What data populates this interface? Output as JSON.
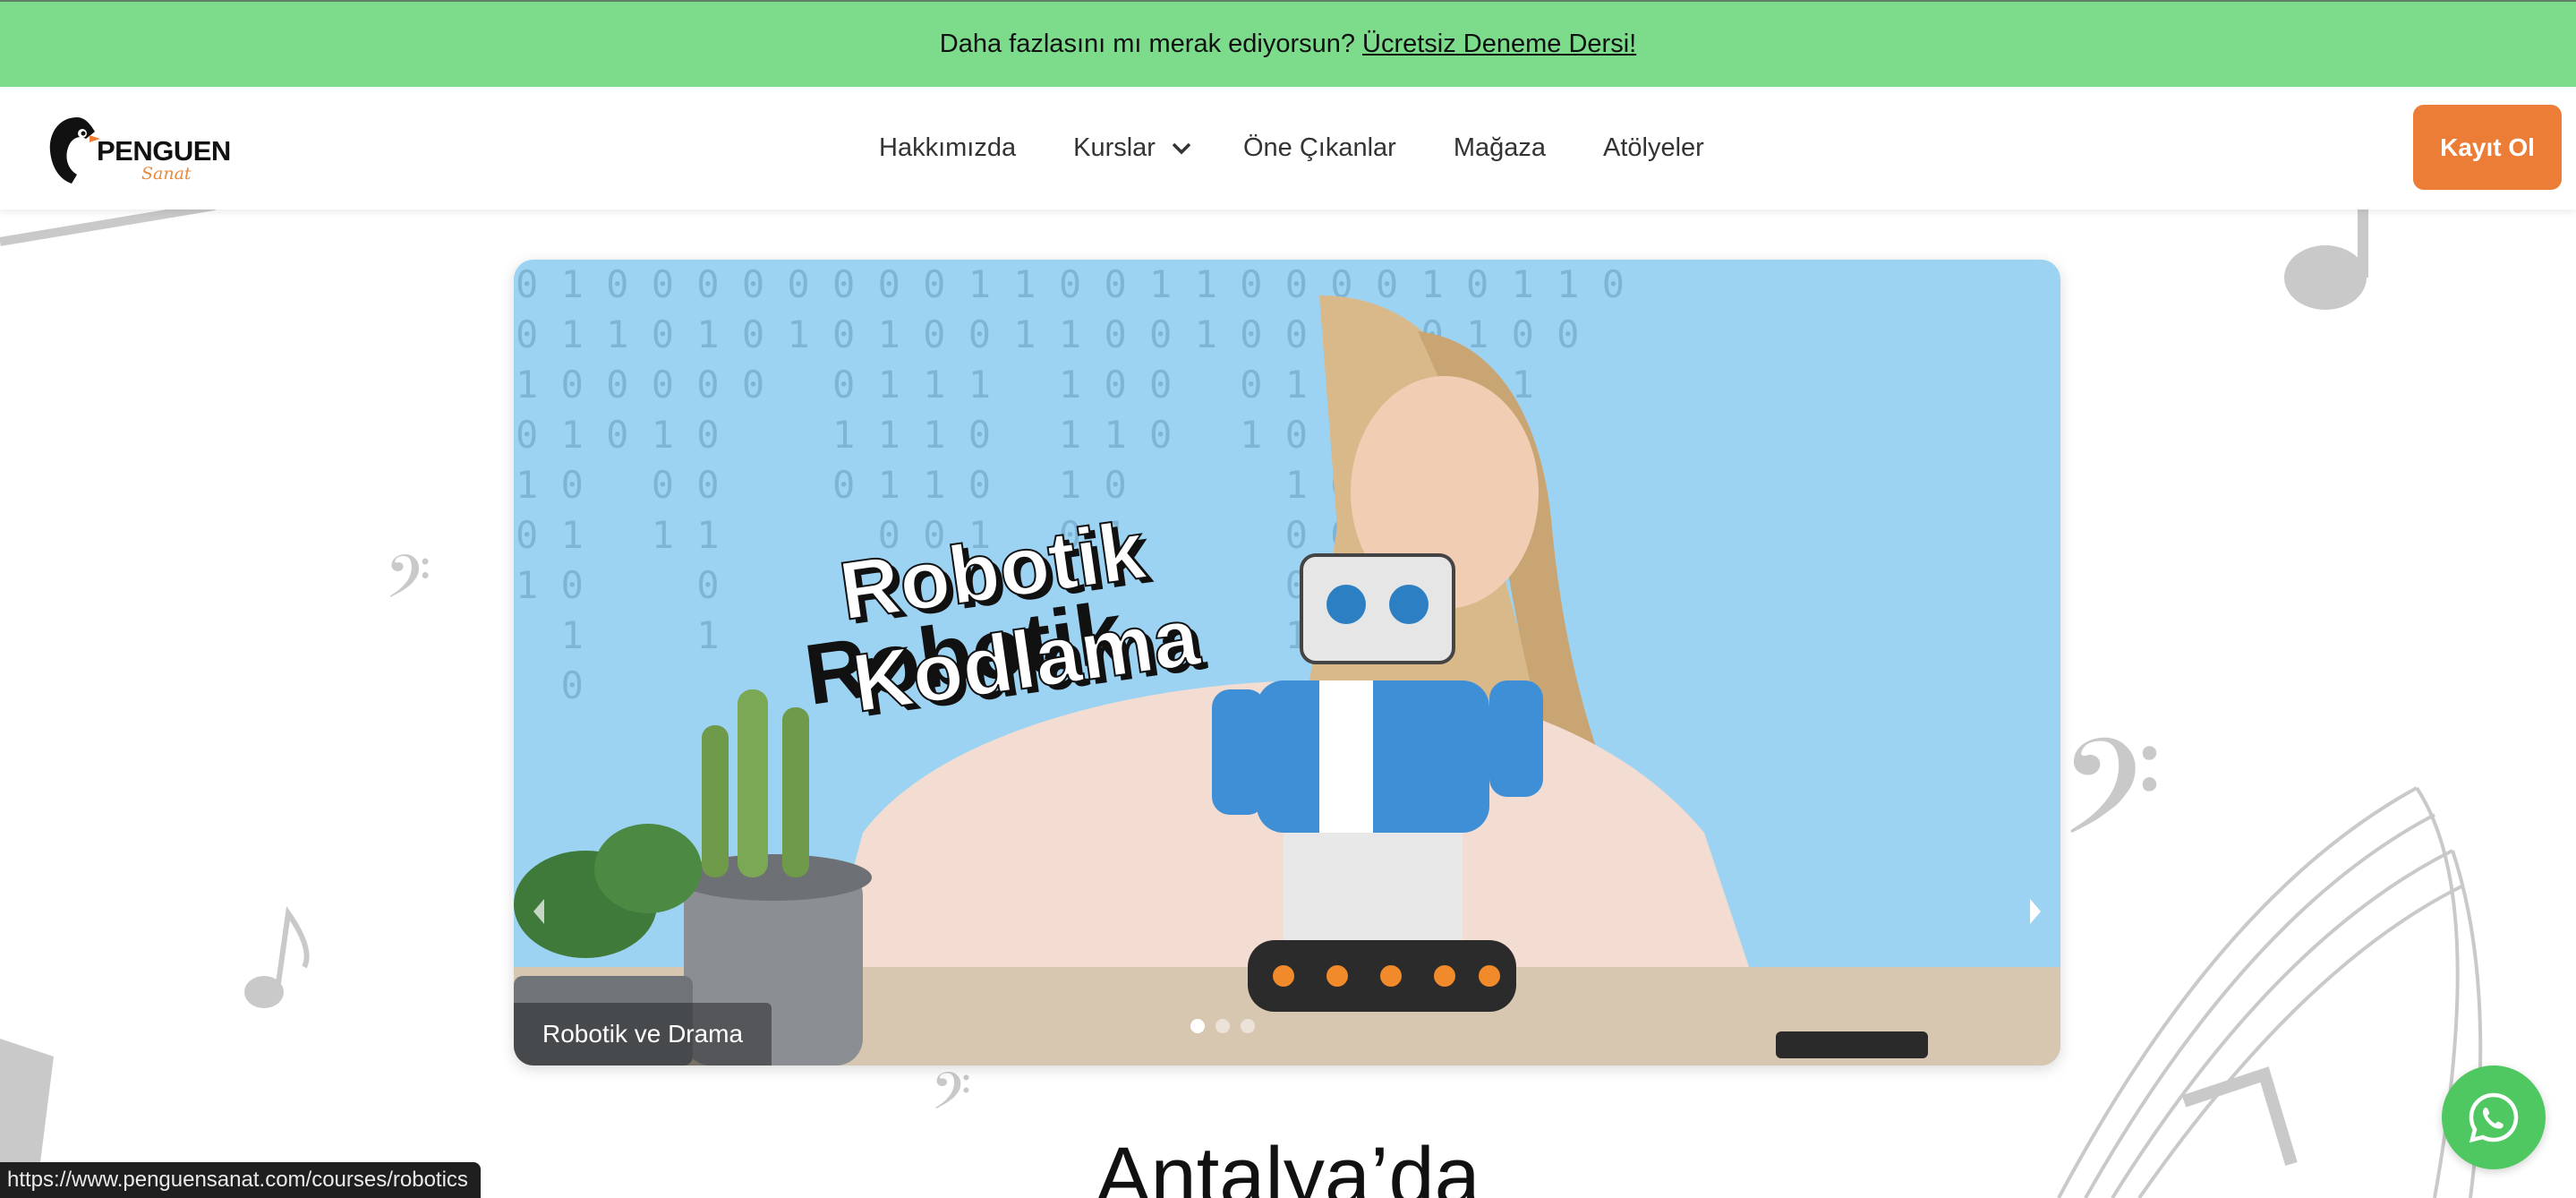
{
  "promo": {
    "text": "Daha fazlasını mı merak ediyorsun?",
    "link": "Ücretsiz Deneme Dersi!"
  },
  "logo": {
    "name": "PENGUEN",
    "sub": "Sanat"
  },
  "nav": {
    "items": [
      {
        "label": "Hakkımızda"
      },
      {
        "label": "Kurslar",
        "dropdown": true
      },
      {
        "label": "Öne Çıkanlar"
      },
      {
        "label": "Mağaza"
      },
      {
        "label": "Atölyeler"
      }
    ],
    "signup": "Kayıt Ol"
  },
  "carousel": {
    "headline_line1": "Robotik",
    "headline_line2": "Kodlama",
    "caption": "Robotik ve Drama",
    "slide_count": 3,
    "active_slide": 1
  },
  "hero": {
    "title": "Antalya’da"
  },
  "status_url": "https://www.penguensanat.com/courses/robotics",
  "colors": {
    "promo_bg": "#7ddc8b",
    "accent": "#ec7d36",
    "carousel_bg": "#9dd3f2",
    "whatsapp": "#4fc862"
  },
  "icons": {
    "chevron": "chevron-down-icon",
    "prev": "chevron-left-icon",
    "next": "chevron-right-icon",
    "whatsapp": "whatsapp-icon"
  }
}
